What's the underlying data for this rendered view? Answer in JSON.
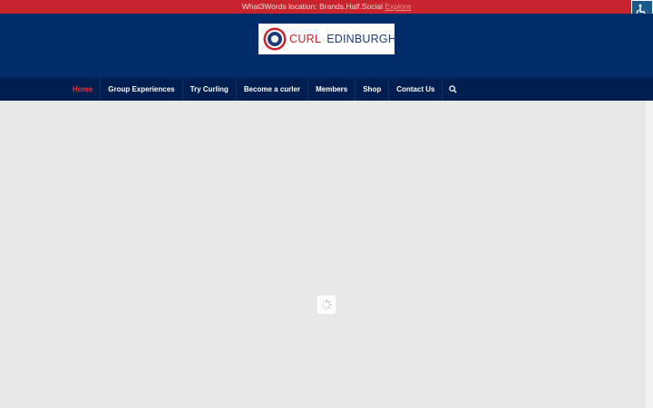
{
  "topbar": {
    "text": "What3Words location: Brands.Half.Social",
    "link": "Explore"
  },
  "logo": {
    "curl": "CURL",
    "edinburgh": "EDINBURGH"
  },
  "nav": {
    "items": [
      {
        "label": "Home",
        "active": true
      },
      {
        "label": "Group Experiences"
      },
      {
        "label": "Try Curling"
      },
      {
        "label": "Become a curler"
      },
      {
        "label": "Members"
      },
      {
        "label": "Shop"
      },
      {
        "label": "Contact Us"
      }
    ]
  },
  "icons": {
    "accessibility": "wheelchair-icon",
    "search": "search-icon",
    "loader": "spinner-icon"
  },
  "colors": {
    "topbar": "#c8242d",
    "header": "#002c6a",
    "nav": "#001e4f",
    "active_nav": "#e53238",
    "content": "#e8e8e8"
  }
}
